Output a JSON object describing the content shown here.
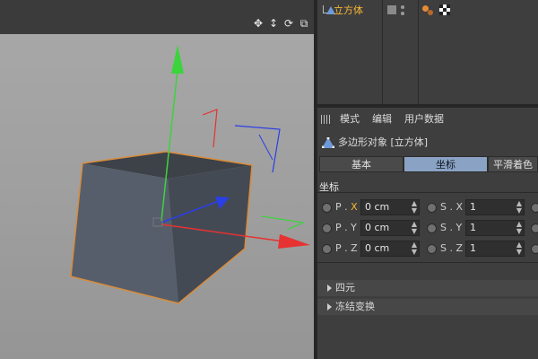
{
  "colors": {
    "accent_orange": "#f7b733",
    "tab_active": "#8aa3c4",
    "axis_y": "#3cd43c",
    "axis_x": "#e63232",
    "axis_z": "#2a3fe6",
    "cube_outline": "#d98c3a"
  },
  "viewport": {
    "icons": [
      "move-icon",
      "scale-icon",
      "rotate-icon",
      "maximize-icon"
    ]
  },
  "object_manager": {
    "object_name": "立方体"
  },
  "attributes": {
    "menu": [
      "模式",
      "编辑",
      "用户数据"
    ],
    "object_title": "多边形对象 [立方体]",
    "tabs": [
      "基本",
      "坐标",
      "平滑着色(P"
    ],
    "active_tab": "坐标",
    "section": "坐标",
    "rows": [
      {
        "pos_prefix": "P . ",
        "pos_axis": "X",
        "pos_value": "0 cm",
        "scale_label": "S . X",
        "scale_value": "1"
      },
      {
        "pos_prefix": "P . ",
        "pos_axis": "Y",
        "pos_value": "0 cm",
        "scale_label": "S . Y",
        "scale_value": "1"
      },
      {
        "pos_prefix": "P . ",
        "pos_axis": "Z",
        "pos_value": "0 cm",
        "scale_label": "S . Z",
        "scale_value": "1"
      }
    ],
    "groups": [
      "四元",
      "冻结变换"
    ]
  }
}
